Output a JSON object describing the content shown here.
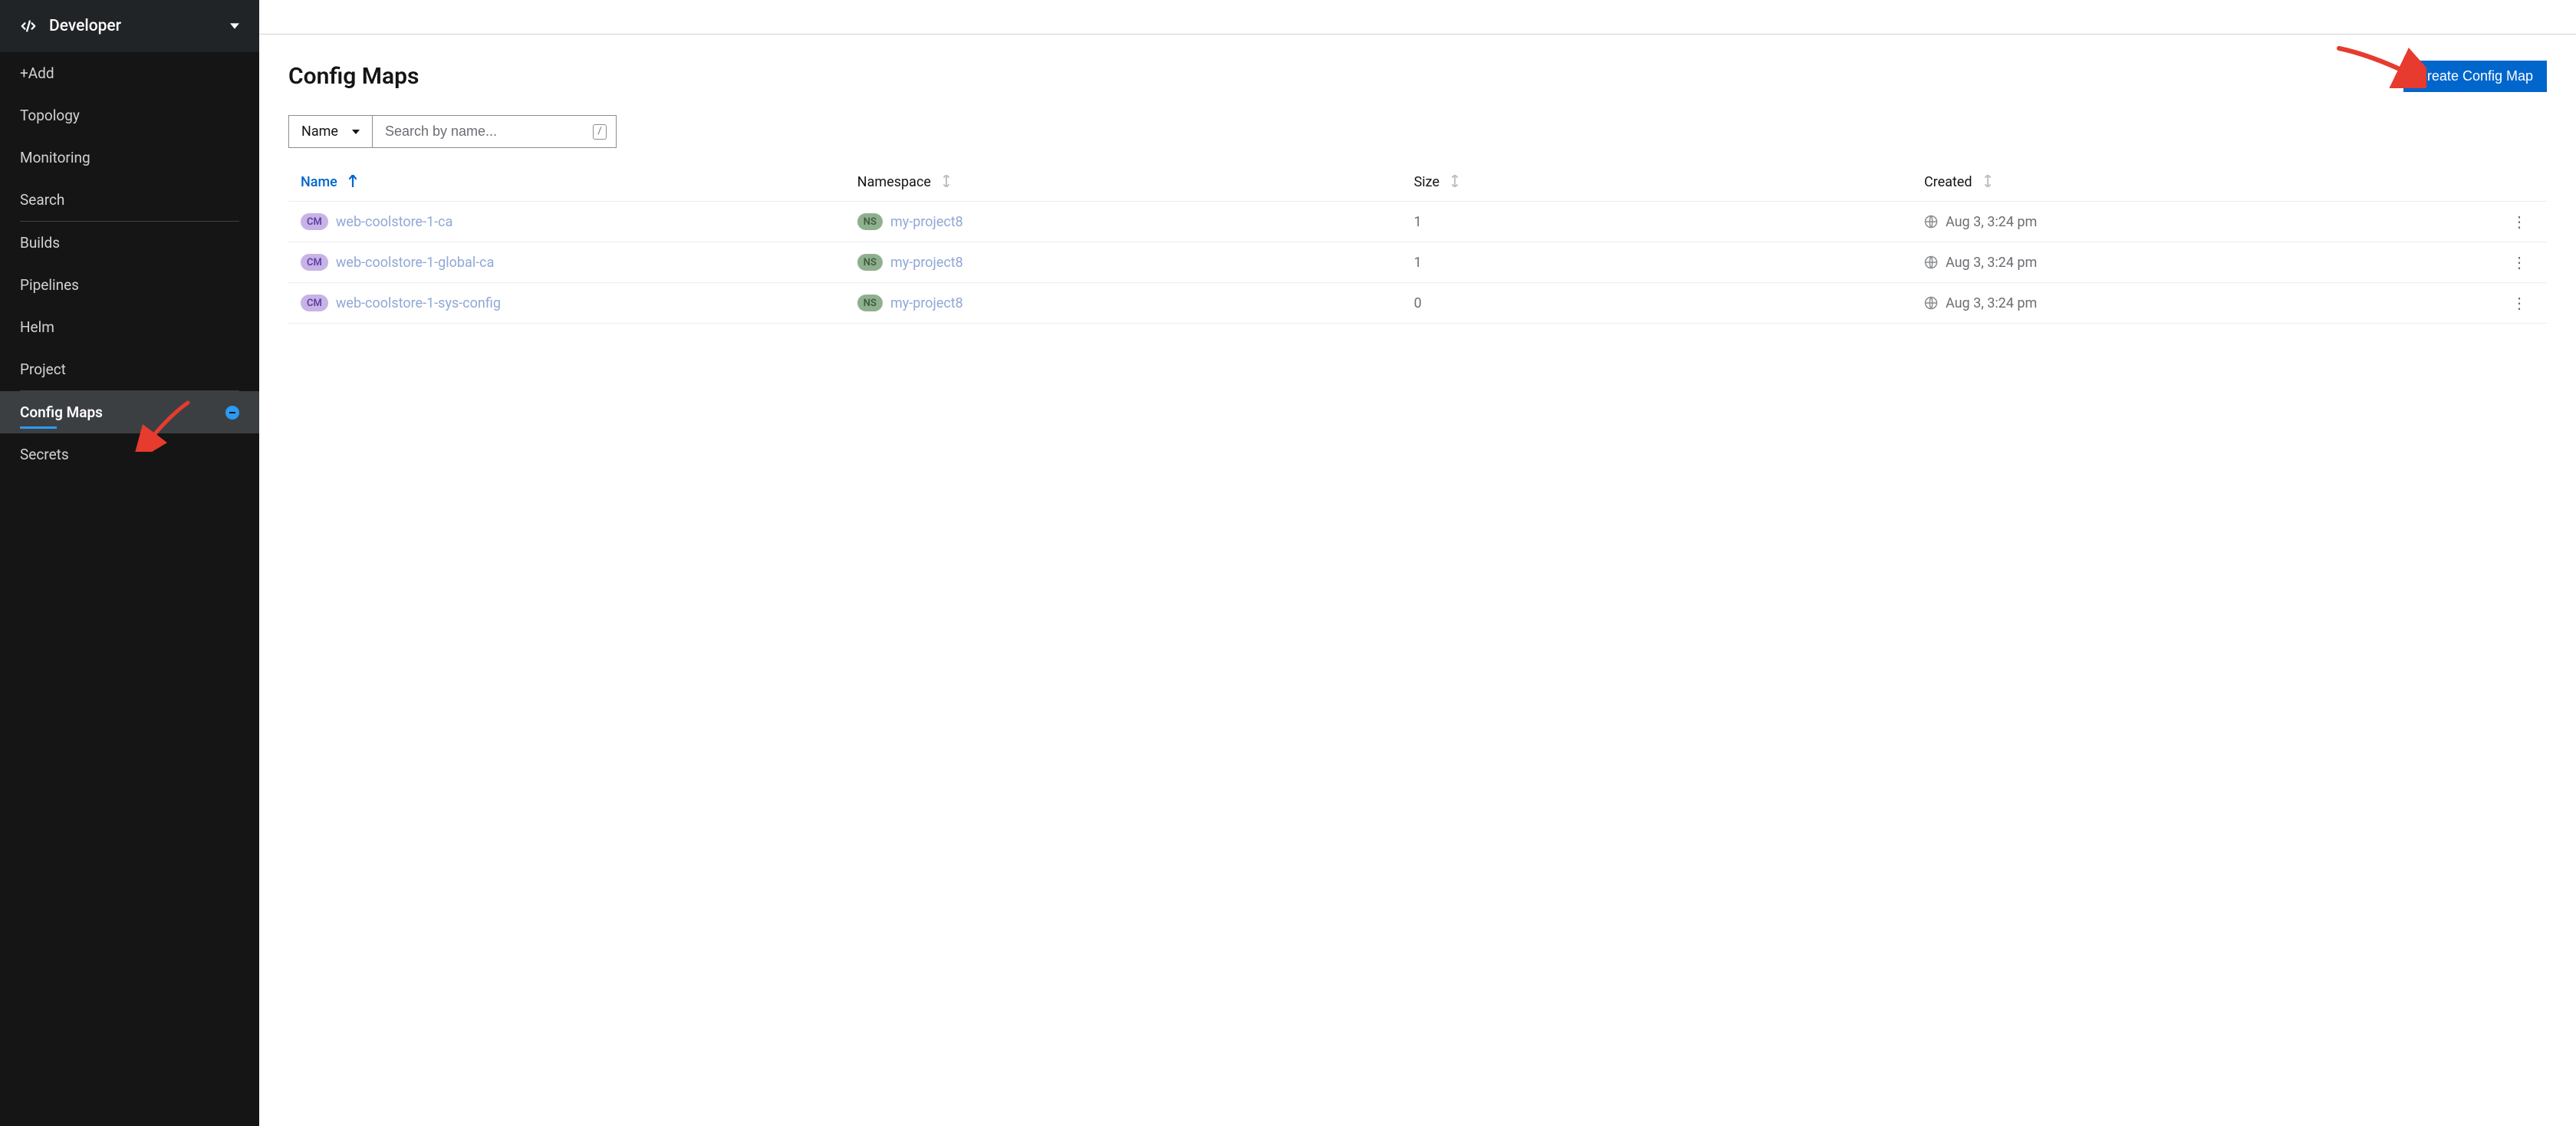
{
  "sidebar": {
    "perspective": "Developer",
    "groups": [
      {
        "items": [
          {
            "id": "add",
            "label": "+Add"
          },
          {
            "id": "topology",
            "label": "Topology"
          },
          {
            "id": "monitoring",
            "label": "Monitoring"
          },
          {
            "id": "search",
            "label": "Search"
          }
        ]
      },
      {
        "items": [
          {
            "id": "builds",
            "label": "Builds"
          },
          {
            "id": "pipelines",
            "label": "Pipelines"
          },
          {
            "id": "helm",
            "label": "Helm"
          },
          {
            "id": "project",
            "label": "Project"
          }
        ]
      },
      {
        "items": [
          {
            "id": "configmaps",
            "label": "Config Maps",
            "active": true,
            "badge": "minus"
          },
          {
            "id": "secrets",
            "label": "Secrets"
          }
        ]
      }
    ]
  },
  "page": {
    "title": "Config Maps",
    "create_button": "Create Config Map",
    "filter": {
      "type_label": "Name",
      "placeholder": "Search by name...",
      "shortcut_hint": "/"
    },
    "columns": {
      "name": "Name",
      "namespace": "Namespace",
      "size": "Size",
      "created": "Created"
    },
    "badges": {
      "cm": "CM",
      "ns": "NS"
    },
    "rows": [
      {
        "name": "web-coolstore-1-ca",
        "namespace": "my-project8",
        "size": "1",
        "created": "Aug 3, 3:24 pm"
      },
      {
        "name": "web-coolstore-1-global-ca",
        "namespace": "my-project8",
        "size": "1",
        "created": "Aug 3, 3:24 pm"
      },
      {
        "name": "web-coolstore-1-sys-config",
        "namespace": "my-project8",
        "size": "0",
        "created": "Aug 3, 3:24 pm"
      }
    ]
  }
}
